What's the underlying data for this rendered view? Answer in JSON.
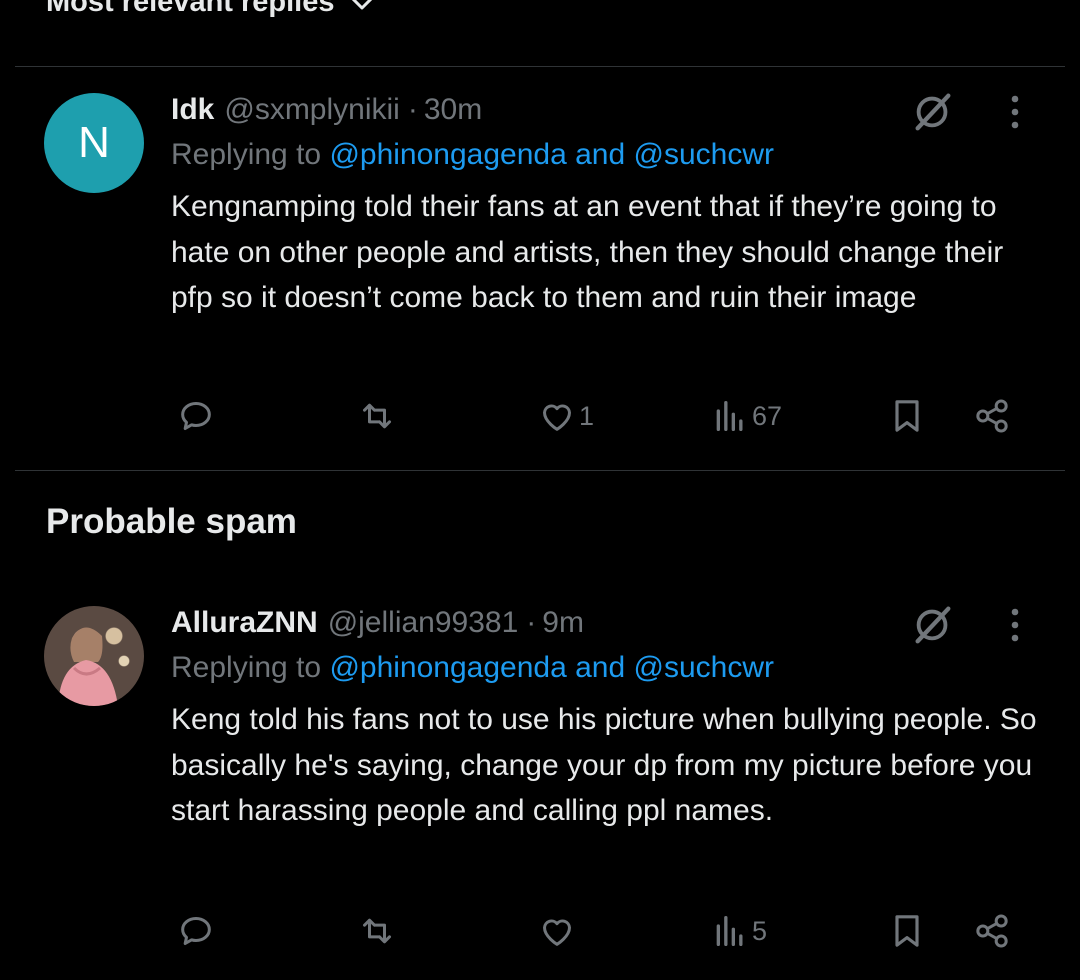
{
  "header": {
    "sort_label": "Most relevant replies"
  },
  "section": {
    "title": "Probable spam"
  },
  "tweets": [
    {
      "avatar_letter": "N",
      "name": "Idk",
      "handle": "@sxmplynikii",
      "separator": "·",
      "time": "30m",
      "replying_prefix": "Replying to ",
      "replying_users": "@phinongagenda and @suchcwr",
      "text": "Kengnamping told their fans at an event that if they’re going to hate on other people and artists, then they should change their pfp so it doesn’t come back to them and ruin their image",
      "likes": "1",
      "views": "67"
    },
    {
      "avatar_letter": "",
      "name": "AlluraZNN",
      "handle": "@jellian99381",
      "separator": "·",
      "time": "9m",
      "replying_prefix": "Replying to ",
      "replying_users": "@phinongagenda and @suchcwr",
      "text": "Keng told his fans not to use his picture when bullying people. So basically he's saying, change your dp from my picture before you start harassing people and calling ppl names.",
      "likes": "",
      "views": "5"
    }
  ],
  "colors": {
    "background": "#000000",
    "text": "#e7e9ea",
    "muted": "#71767b",
    "link": "#1d9bf0",
    "avatar_bg": "#1e9fae"
  },
  "icons": [
    "chevron-down-icon",
    "grok-icon",
    "more-icon",
    "reply-icon",
    "retweet-icon",
    "like-icon",
    "views-icon",
    "bookmark-icon",
    "share-icon"
  ]
}
